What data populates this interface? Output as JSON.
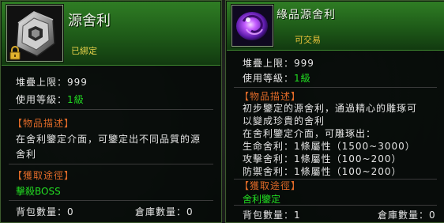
{
  "left": {
    "title": "源舍利",
    "bind_status": "已綁定",
    "stack_limit_label": "堆疊上限：",
    "stack_limit_value": "999",
    "level_label": "使用等級：",
    "level_value": "1級",
    "desc_header": "【物品描述】",
    "desc_text": "在舍利鑒定介面，可鑒定出不同品質的源舍利",
    "obtain_header": "【獲取途徑】",
    "obtain_value": "擊殺BOSS",
    "bag_label": "背包數量：",
    "bag_value": "0",
    "storage_label": "倉庫數量：",
    "storage_value": "0",
    "icon": "relic-stone-icon",
    "lock_icon": "padlock-icon"
  },
  "right": {
    "title": "綠品源舍利",
    "trade_status": "可交易",
    "stack_limit_label": "堆疊上限：",
    "stack_limit_value": "999",
    "level_label": "使用等級：",
    "level_value": "1級",
    "desc_header": "【物品描述】",
    "desc_lines": [
      "初步鑒定的源舍利，通過精心的雕琢可",
      "以變成珍貴的舍利",
      "在舍利鑒定介面，可雕琢出：",
      "生命舍利：1條屬性（1500~3000）",
      "攻擊舍利：1條屬性（100~200）",
      "防禦舍利：1條屬性（100~200）"
    ],
    "obtain_header": "【獲取途徑】",
    "obtain_value": "舍利鑒定",
    "bag_label": "背包數量：",
    "bag_value": "1",
    "storage_label": "倉庫數量：",
    "storage_value": "0",
    "icon": "purple-orb-icon"
  },
  "colors": {
    "header_green": "#2f7d24",
    "section_orange": "#e06a28",
    "value_green": "#22dd22",
    "bind_yellow": "#e8d24a"
  }
}
